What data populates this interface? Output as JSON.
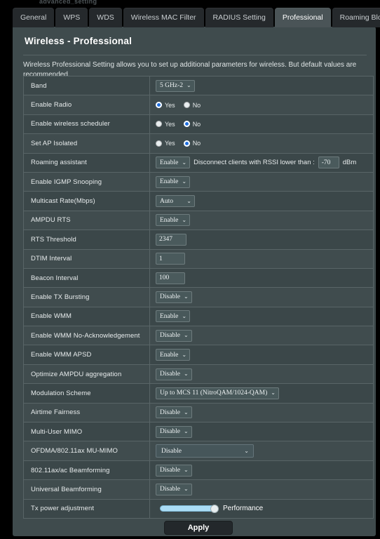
{
  "top_crumb": "advanced_setting",
  "tabs": [
    {
      "label": "General",
      "active": false
    },
    {
      "label": "WPS",
      "active": false
    },
    {
      "label": "WDS",
      "active": false
    },
    {
      "label": "Wireless MAC Filter",
      "active": false
    },
    {
      "label": "RADIUS Setting",
      "active": false
    },
    {
      "label": "Professional",
      "active": true
    },
    {
      "label": "Roaming Block List",
      "active": false
    }
  ],
  "panel": {
    "title": "Wireless - Professional",
    "description": "Wireless Professional Setting allows you to set up additional parameters for wireless. But default values are recommended."
  },
  "rows": {
    "band": {
      "label": "Band",
      "value": "5 GHz-2"
    },
    "enable_radio": {
      "label": "Enable Radio",
      "yes": "Yes",
      "no": "No",
      "selected": "yes"
    },
    "wireless_sched": {
      "label": "Enable wireless scheduler",
      "yes": "Yes",
      "no": "No",
      "selected": "no"
    },
    "ap_isolated": {
      "label": "Set AP Isolated",
      "yes": "Yes",
      "no": "No",
      "selected": "no"
    },
    "roaming_assistant": {
      "label": "Roaming assistant",
      "value": "Enable",
      "note": "Disconnect clients with RSSI lower than :",
      "rssi": "-70",
      "unit": "dBm"
    },
    "igmp_snooping": {
      "label": "Enable IGMP Snooping",
      "value": "Enable"
    },
    "multicast_rate": {
      "label": "Multicast Rate(Mbps)",
      "value": "Auto"
    },
    "ampdu_rts": {
      "label": "AMPDU RTS",
      "value": "Enable"
    },
    "rts_threshold": {
      "label": "RTS Threshold",
      "value": "2347"
    },
    "dtim_interval": {
      "label": "DTIM Interval",
      "value": "1"
    },
    "beacon_interval": {
      "label": "Beacon Interval",
      "value": "100"
    },
    "tx_bursting": {
      "label": "Enable TX Bursting",
      "value": "Disable"
    },
    "wmm": {
      "label": "Enable WMM",
      "value": "Enable"
    },
    "wmm_noack": {
      "label": "Enable WMM No-Acknowledgement",
      "value": "Disable"
    },
    "wmm_apsd": {
      "label": "Enable WMM APSD",
      "value": "Enable"
    },
    "optimize_ampdu": {
      "label": "Optimize AMPDU aggregation",
      "value": "Disable"
    },
    "modulation": {
      "label": "Modulation Scheme",
      "value": "Up to MCS 11 (NitroQAM/1024-QAM)"
    },
    "airtime_fairness": {
      "label": "Airtime Fairness",
      "value": "Disable"
    },
    "mu_mimo": {
      "label": "Multi-User MIMO",
      "value": "Disable"
    },
    "ofdma": {
      "label": "OFDMA/802.11ax MU-MIMO",
      "value": "Disable"
    },
    "beamforming_ax": {
      "label": "802.11ax/ac Beamforming",
      "value": "Disable"
    },
    "universal_bf": {
      "label": "Universal Beamforming",
      "value": "Disable"
    },
    "tx_power": {
      "label": "Tx power adjustment",
      "slider_label": "Performance",
      "slider_percent": 100
    }
  },
  "apply": {
    "label": "Apply"
  },
  "icons": {
    "chevron_down": "⌄"
  },
  "colors": {
    "panel_bg": "#3f4b4d",
    "row_bg": "#3b4749",
    "row_alt_bg": "#404c4e",
    "border": "#596567",
    "tab_active_bg": "#4a5457",
    "tab_bg": "#25292c",
    "radio_on": "#1f6fe0",
    "slider_track": "#aadcf5",
    "apply_bg": "#23282b"
  }
}
